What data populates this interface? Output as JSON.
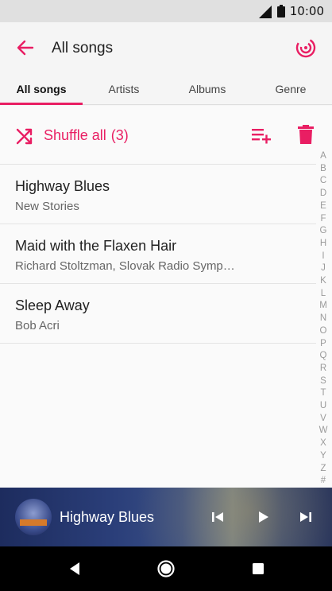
{
  "status": {
    "time": "10:00"
  },
  "header": {
    "title": "All songs"
  },
  "tabs": [
    {
      "label": "All songs",
      "active": true
    },
    {
      "label": "Artists",
      "active": false
    },
    {
      "label": "Albums",
      "active": false
    },
    {
      "label": "Genre",
      "active": false
    }
  ],
  "shuffle": {
    "label": "Shuffle all",
    "count": "(3)"
  },
  "songs": [
    {
      "title": "Highway Blues",
      "artist": "New Stories"
    },
    {
      "title": "Maid with the Flaxen Hair",
      "artist": "Richard Stoltzman, Slovak Radio Symp…"
    },
    {
      "title": "Sleep Away",
      "artist": "Bob Acri"
    }
  ],
  "alphabet": [
    "A",
    "B",
    "C",
    "D",
    "E",
    "F",
    "G",
    "H",
    "I",
    "J",
    "K",
    "L",
    "M",
    "N",
    "O",
    "P",
    "Q",
    "R",
    "S",
    "T",
    "U",
    "V",
    "W",
    "X",
    "Y",
    "Z",
    "#"
  ],
  "player": {
    "title": "Highway Blues"
  },
  "colors": {
    "accent": "#e91e63"
  },
  "icons": {
    "back": "arrow-left-icon",
    "cast": "cast-icon",
    "shuffle": "shuffle-icon",
    "playlist_add": "playlist-add-icon",
    "delete": "trash-icon",
    "previous": "skip-previous-icon",
    "play": "play-icon",
    "next": "skip-next-icon"
  }
}
